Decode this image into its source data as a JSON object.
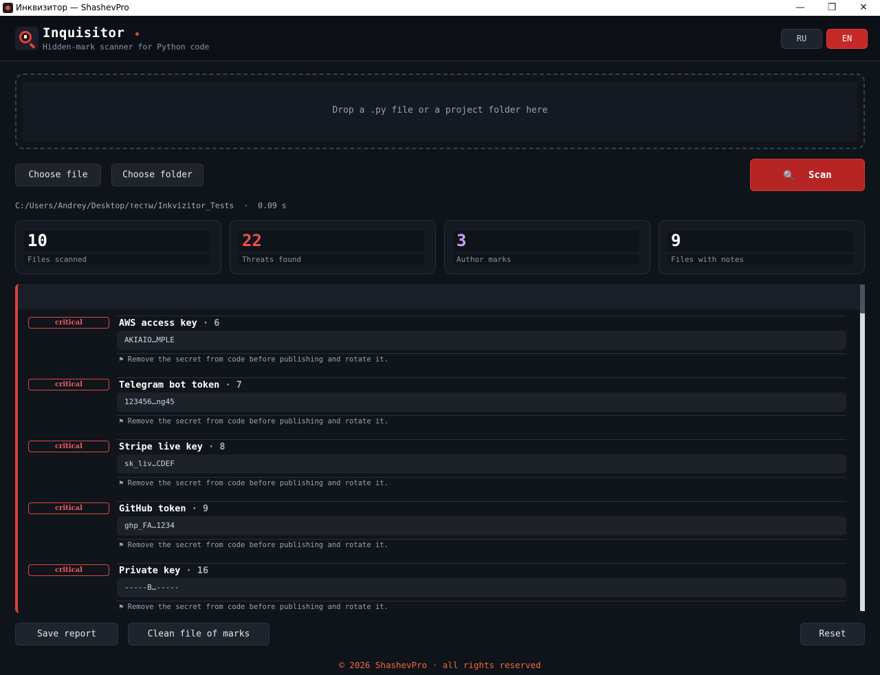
{
  "window": {
    "title": "Инквизитор — ShashevPro",
    "minimize": "—",
    "maximize": "❐",
    "close": "✕"
  },
  "header": {
    "app_name": "Inquisitor",
    "subtitle": "Hidden-mark scanner for Python code",
    "lang_ru": "RU",
    "lang_en": "EN",
    "active_lang": "EN"
  },
  "dropzone": {
    "text": "Drop a .py file or a project folder here"
  },
  "actions": {
    "choose_file": "Choose file",
    "choose_folder": "Choose folder",
    "scan": "Scan",
    "scan_icon": "magnifier-icon"
  },
  "scan_info": {
    "path": "C:/Users/Andrey/Desktop/тесты/Inkvizitor_Tests",
    "separator": "·",
    "duration": "0.09 s"
  },
  "stats": [
    {
      "value": "10",
      "label": "Files scanned",
      "color": "#ffffff"
    },
    {
      "value": "22",
      "label": "Threats found",
      "color": "#f0504a"
    },
    {
      "value": "3",
      "label": "Author marks",
      "color": "#c9a2ff"
    },
    {
      "value": "9",
      "label": "Files with notes",
      "color": "#ffffff"
    }
  ],
  "findings": [
    {
      "severity": "critical",
      "title": "AWS access key",
      "line": "6",
      "snippet": "AKIAIO…MPLE",
      "note": "Remove the secret from code before publishing and rotate it."
    },
    {
      "severity": "critical",
      "title": "Telegram bot token",
      "line": "7",
      "snippet": "123456…ng45",
      "note": "Remove the secret from code before publishing and rotate it."
    },
    {
      "severity": "critical",
      "title": "Stripe live key",
      "line": "8",
      "snippet": "sk_liv…CDEF",
      "note": "Remove the secret from code before publishing and rotate it."
    },
    {
      "severity": "critical",
      "title": "GitHub token",
      "line": "9",
      "snippet": "ghp_FA…1234",
      "note": "Remove the secret from code before publishing and rotate it."
    },
    {
      "severity": "critical",
      "title": "Private key",
      "line": "16",
      "snippet": "-----B…-----",
      "note": "Remove the secret from code before publishing and rotate it."
    }
  ],
  "finding_separator": "·",
  "note_icon": "flag-icon",
  "bottom": {
    "save_report": "Save report",
    "clean_file": "Clean file of marks",
    "reset": "Reset"
  },
  "footer": {
    "text": "© 2026 ShashevPro · all rights reserved"
  },
  "colors": {
    "accent": "#c62828",
    "critical": "#e04848",
    "background": "#0f131a"
  }
}
